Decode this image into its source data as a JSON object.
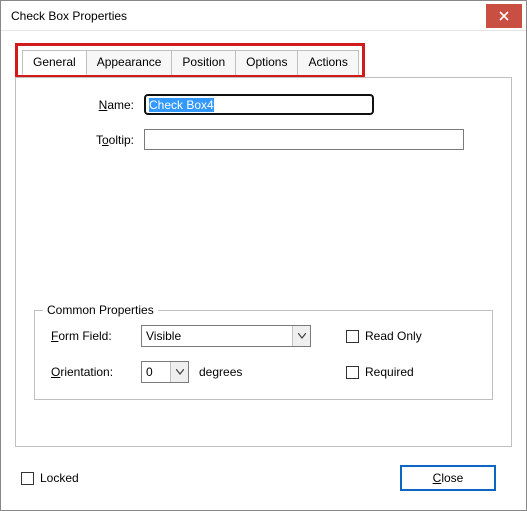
{
  "window": {
    "title": "Check Box Properties"
  },
  "tabs": {
    "general": "General",
    "appearance": "Appearance",
    "position": "Position",
    "options": "Options",
    "actions": "Actions"
  },
  "fields": {
    "name_label_pre": "N",
    "name_label_post": "ame:",
    "name_value": "Check Box4",
    "tooltip_label_pre": "T",
    "tooltip_label_post": "ooltip:",
    "tooltip_value": ""
  },
  "common": {
    "legend": "Common Properties",
    "formfield_label_pre": "F",
    "formfield_label_post": "orm Field:",
    "formfield_value": "Visible",
    "orientation_label_pre": "O",
    "orientation_label_post": "rientation:",
    "orientation_value": "0",
    "degrees": "degrees",
    "readonly_label": "Read Only",
    "required_label": "Required"
  },
  "footer": {
    "locked_label": "Locked",
    "close_pre": "C",
    "close_post": "lose"
  }
}
